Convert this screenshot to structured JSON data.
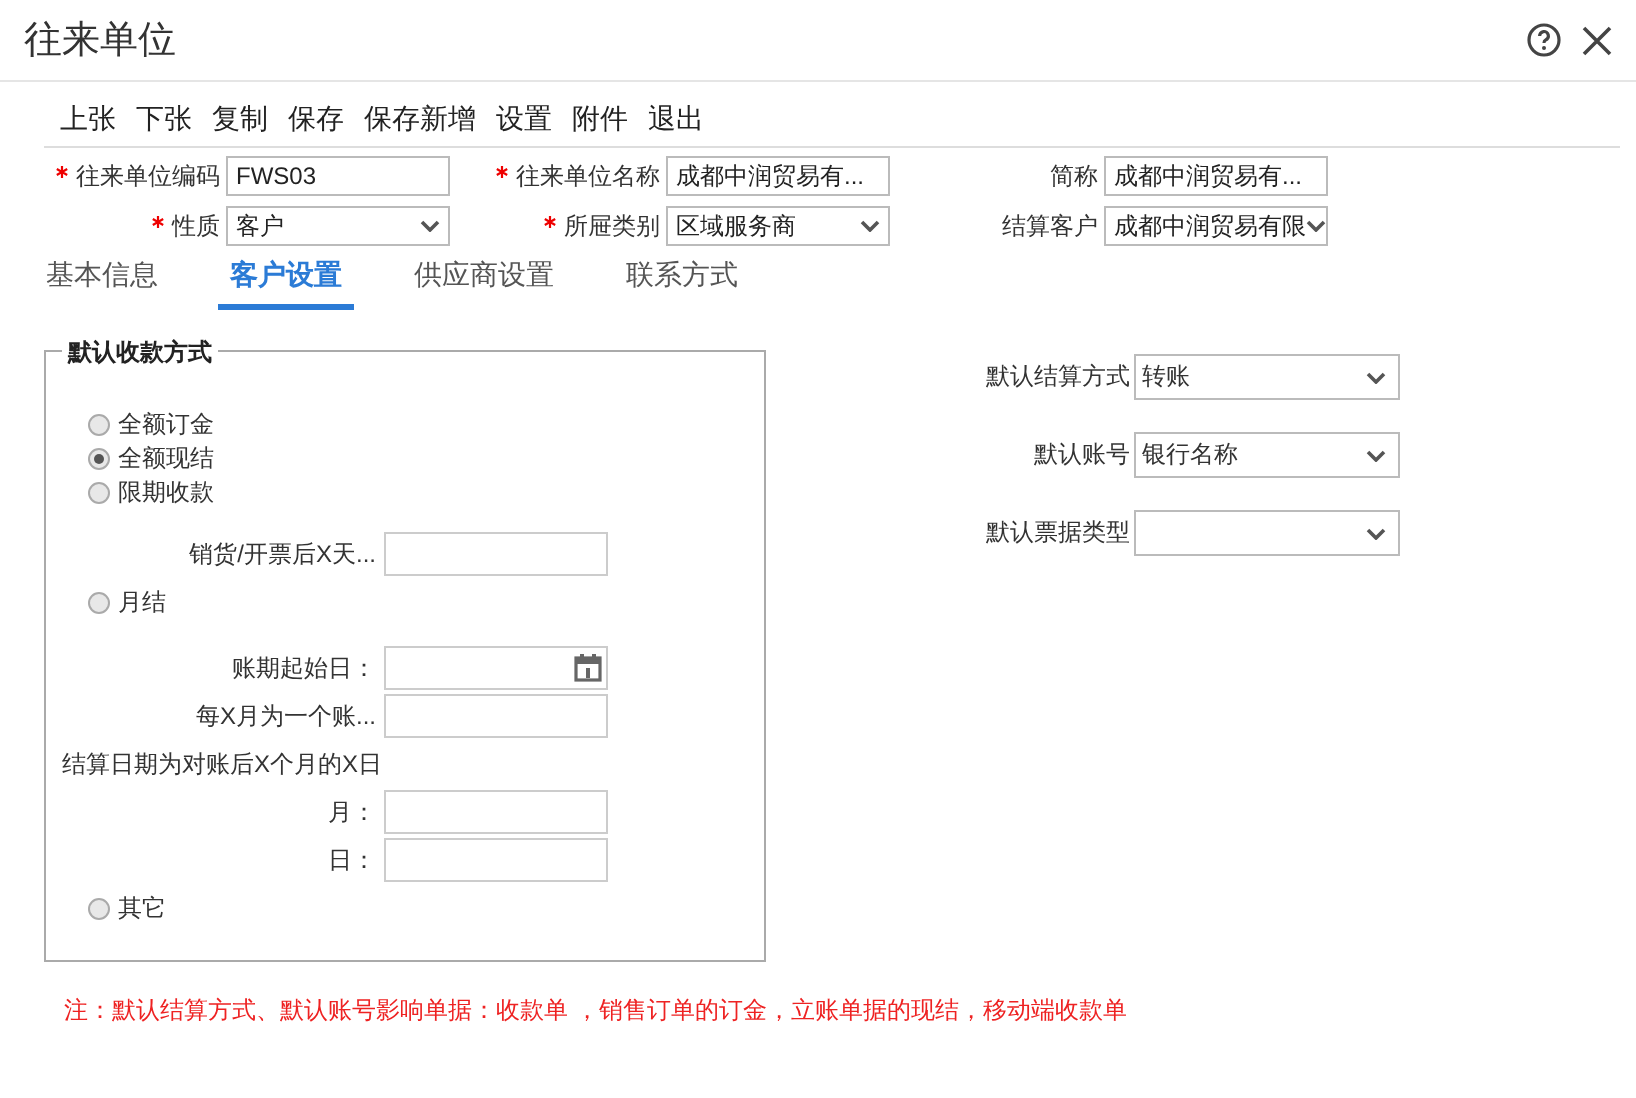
{
  "window": {
    "title": "往来单位"
  },
  "toolbar": [
    "上张",
    "下张",
    "复制",
    "保存",
    "保存新增",
    "设置",
    "附件",
    "退出"
  ],
  "form": [
    {
      "label": "往来单位编码",
      "required": true,
      "kind": "text",
      "value": "FWS03"
    },
    {
      "label": "往来单位名称",
      "required": true,
      "kind": "text",
      "value": "成都中润贸易有..."
    },
    {
      "label": "简称",
      "required": false,
      "kind": "text",
      "value": "成都中润贸易有..."
    },
    {
      "label": "性质",
      "required": true,
      "kind": "select",
      "value": "客户"
    },
    {
      "label": "所屉类别",
      "required": true,
      "kind": "select",
      "value": "区域服务商"
    },
    {
      "label": "结算客户",
      "required": false,
      "kind": "select",
      "value": "成都中润贸易有限"
    }
  ],
  "tabs": [
    {
      "label": "基本信息",
      "selected": false
    },
    {
      "label": "客户设置",
      "selected": true
    },
    {
      "label": "供应商设置",
      "selected": false
    },
    {
      "label": "联系方式",
      "selected": false
    }
  ],
  "group": {
    "legend": "默认收款方式",
    "items": [
      {
        "kind": "radio",
        "label": "全额订金",
        "selected": false
      },
      {
        "kind": "radio",
        "label": "全额现结",
        "selected": true
      },
      {
        "kind": "radio",
        "label": "限期收款",
        "selected": false
      },
      {
        "kind": "field",
        "label": "销货/开票后X天..."
      },
      {
        "kind": "radio",
        "label": "月结",
        "selected": false
      },
      {
        "kind": "date",
        "label": "账期起始日："
      },
      {
        "kind": "field",
        "label": "每X月为一个账..."
      },
      {
        "kind": "text",
        "label": "结算日期为对账后X个月的X日"
      },
      {
        "kind": "field",
        "label": "月："
      },
      {
        "kind": "field",
        "label": "日："
      },
      {
        "kind": "radio",
        "label": "其它",
        "selected": false
      }
    ]
  },
  "defaults": [
    {
      "label": "默认结算方式",
      "value": "转账"
    },
    {
      "label": "默认账号",
      "value": "银行名称"
    },
    {
      "label": "默认票据类型"
    }
  ],
  "note": "注：默认结算方式、默认账号影响单据：收款单 ，销售订单的订金，立账单据的现结，移动端收款单"
}
